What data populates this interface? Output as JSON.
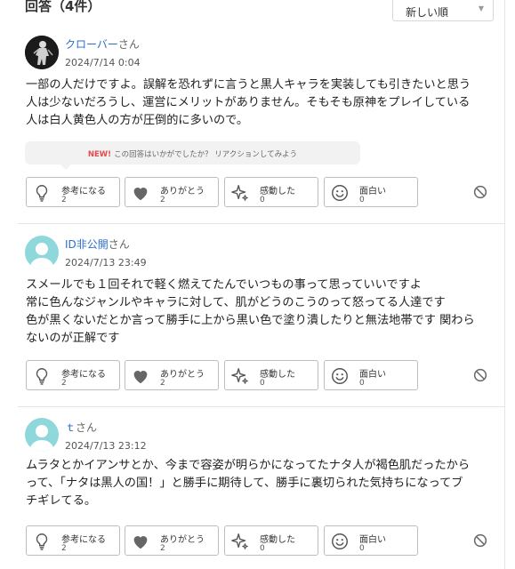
{
  "header": {
    "title": "回答（4件）",
    "sort_value": "新しい順"
  },
  "colors": {
    "link": "#2d6ec6",
    "new_badge": "#e64a4a",
    "avatar_default": "#8ed8dc",
    "border": "#bdbdbd"
  },
  "answers": [
    {
      "user_name": "クローバー",
      "honorific": "さん",
      "date": "2024/7/14 0:04",
      "avatar_icon": "character-avatar-icon",
      "lines": [
        "一部の人だけですよ。誤解を恐れずに言うと黒人キャラを実装しても引きたいと思う",
        "人は少ないだろうし、運営にメリットがありません。そもそも原神をプレイしている",
        "人は白人黄色人の方が圧倒的に多いので。"
      ],
      "promo": {
        "badge": "NEW!",
        "text": "この回答はいかがでしたか？ リアクションしてみよう"
      },
      "reactions": [
        {
          "icon": "lightbulb-icon",
          "label": "参考になる",
          "count": "2"
        },
        {
          "icon": "heart-icon",
          "label": "ありがとう",
          "count": "2"
        },
        {
          "icon": "sparkle-icon",
          "label": "感動した",
          "count": "0"
        },
        {
          "icon": "smile-icon",
          "label": "面白い",
          "count": "0"
        }
      ]
    },
    {
      "user_name": "ID非公開",
      "honorific": "さん",
      "date": "2024/7/13 23:49",
      "avatar_icon": "default-user-icon",
      "lines": [
        "スメールでも１回それで軽く燃えてたんでいつもの事って思っていいですよ",
        "常に色んなジャンルやキャラに対して、肌がどうのこうのって怒ってる人達です",
        "色が黒くないだとか言って勝手に上から黒い色で塗り潰したりと無法地帯です 関わら",
        "ないのが正解です"
      ],
      "reactions": [
        {
          "icon": "lightbulb-icon",
          "label": "参考になる",
          "count": "2"
        },
        {
          "icon": "heart-icon",
          "label": "ありがとう",
          "count": "2"
        },
        {
          "icon": "sparkle-icon",
          "label": "感動した",
          "count": "0"
        },
        {
          "icon": "smile-icon",
          "label": "面白い",
          "count": "0"
        }
      ]
    },
    {
      "user_name": "ｔ",
      "honorific": "さん",
      "date": "2024/7/13 23:12",
      "avatar_icon": "default-user-icon",
      "lines": [
        "ムラタとかイアンサとか、今まで容姿が明らかになってたナタ人が褐色肌だったから",
        "って、「ナタは黒人の国！」と勝手に期待して、勝手に裏切られた気持ちになってブ",
        "チギレてる。"
      ],
      "reactions": [
        {
          "icon": "lightbulb-icon",
          "label": "参考になる",
          "count": "2"
        },
        {
          "icon": "heart-icon",
          "label": "ありがとう",
          "count": "2"
        },
        {
          "icon": "sparkle-icon",
          "label": "感動した",
          "count": "0"
        },
        {
          "icon": "smile-icon",
          "label": "面白い",
          "count": "0"
        }
      ]
    }
  ]
}
